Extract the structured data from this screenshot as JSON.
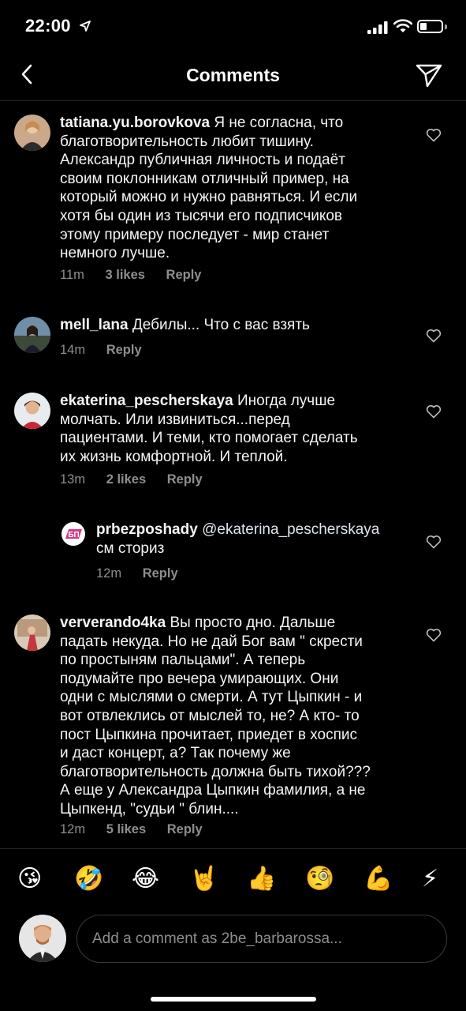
{
  "status_bar": {
    "time": "22:00",
    "battery_level": 0.3
  },
  "header": {
    "title": "Comments",
    "back_icon": "chevron-left-icon",
    "send_icon": "paper-plane-icon"
  },
  "comments": [
    {
      "username": "tatiana.yu.borovkova",
      "lines": [
        "Я не согласна, что",
        "благотворительность любит тишину.",
        "Александр публичная личность и подаёт",
        "своим поклонникам отличный пример, на",
        "который можно и нужно равняться. И если",
        "хотя бы один из тысячи его подписчиков",
        "этому примеру последует - мир станет",
        "немного лучше."
      ],
      "time": "11m",
      "likes": "3 likes",
      "reply": "Reply"
    },
    {
      "username": "mell_lana",
      "lines": [
        "Дебилы... Что с вас взять"
      ],
      "time": "14m",
      "likes": "",
      "reply": "Reply"
    },
    {
      "username": "ekaterina_pescherskaya",
      "lines": [
        "Иногда лучше",
        "молчать. Или извиниться...перед",
        "пациентами. И теми, кто помогает сделать",
        "их жизнь комфортной. И теплой."
      ],
      "time": "13m",
      "likes": "2 likes",
      "reply": "Reply"
    },
    {
      "username": "prbezposhady",
      "mention": "@ekaterina_pescherskaya",
      "lines": [
        "см сториз"
      ],
      "avatar_text": "БП",
      "time": "12m",
      "likes": "",
      "reply": "Reply"
    },
    {
      "username": "ververando4ka",
      "lines": [
        "Вы просто дно. Дальше",
        "падать некуда. Но не дай Бог вам \" скрести",
        "по простыням пальцами\". А теперь",
        "подумайте про вечера умирающих. Они",
        "одни с мыслями о смерти. А тут Цыпкин - и",
        "вот отвлеклись от мыслей то, не? А кто- то",
        "пост Цыпкина прочитает, приедет в хоспис",
        "и даст концерт, а? Так почему же",
        "благотворительность должна быть тихой???",
        "А еще у Александра Цыпкин фамилия, а не",
        "Цыпкенд, \"судьи \" блин...."
      ],
      "time": "12m",
      "likes": "5 likes",
      "reply": "Reply"
    }
  ],
  "emoji_bar": [
    "😘",
    "🤣",
    "😂",
    "🤘",
    "👍",
    "🧐",
    "💪",
    "⚡"
  ],
  "composer": {
    "placeholder": "Add a comment as 2be_barbarossa..."
  },
  "colors": {
    "background": "#000000",
    "text": "#ffffff",
    "secondary": "#8e8e8e",
    "divider": "#262626"
  }
}
